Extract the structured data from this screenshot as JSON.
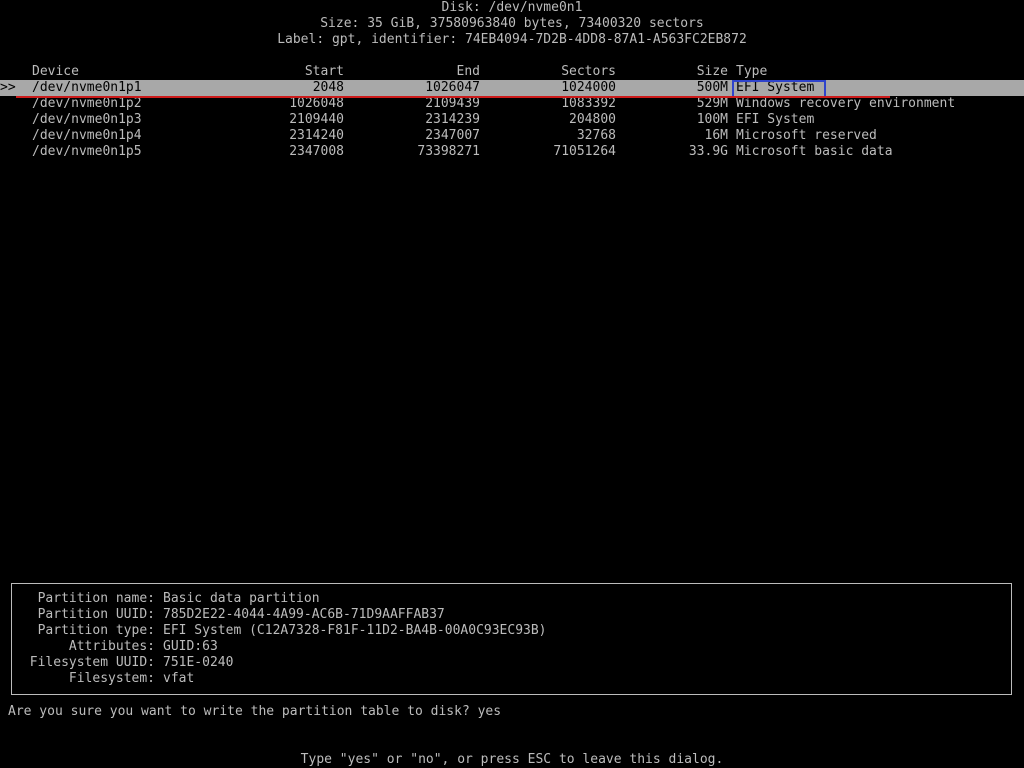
{
  "header": {
    "disk": "Disk: /dev/nvme0n1",
    "size": "Size: 35 GiB, 37580963840 bytes, 73400320 sectors",
    "label": "Label: gpt, identifier: 74EB4094-7D2B-4DD8-87A1-A563FC2EB872"
  },
  "table": {
    "headers": {
      "device": "Device",
      "start": "Start",
      "end": "End",
      "sectors": "Sectors",
      "size": "Size",
      "type": "Type"
    },
    "cursor": ">>",
    "rows": [
      {
        "device": "/dev/nvme0n1p1",
        "start": "2048",
        "end": "1026047",
        "sectors": "1024000",
        "size": "500M",
        "type": "EFI System"
      },
      {
        "device": "/dev/nvme0n1p2",
        "start": "1026048",
        "end": "2109439",
        "sectors": "1083392",
        "size": "529M",
        "type": "Windows recovery environment"
      },
      {
        "device": "/dev/nvme0n1p3",
        "start": "2109440",
        "end": "2314239",
        "sectors": "204800",
        "size": "100M",
        "type": "EFI System"
      },
      {
        "device": "/dev/nvme0n1p4",
        "start": "2314240",
        "end": "2347007",
        "sectors": "32768",
        "size": "16M",
        "type": "Microsoft reserved"
      },
      {
        "device": "/dev/nvme0n1p5",
        "start": "2347008",
        "end": "73398271",
        "sectors": "71051264",
        "size": "33.9G",
        "type": "Microsoft basic data"
      }
    ]
  },
  "info": [
    {
      "label": "Partition name:",
      "value": "Basic data partition"
    },
    {
      "label": "Partition UUID:",
      "value": "785D2E22-4044-4A99-AC6B-71D9AAFFAB37"
    },
    {
      "label": "Partition type:",
      "value": "EFI System (C12A7328-F81F-11D2-BA4B-00A0C93EC93B)"
    },
    {
      "label": "Attributes:",
      "value": "GUID:63"
    },
    {
      "label": "Filesystem UUID:",
      "value": "751E-0240"
    },
    {
      "label": "Filesystem:",
      "value": "vfat"
    }
  ],
  "prompt": {
    "question": "Are you sure you want to write the partition table to disk?",
    "answer": "yes"
  },
  "hint": "Type \"yes\" or \"no\", or press ESC to leave this dialog.",
  "colors": {
    "background": "#000000",
    "text": "#bcbcbc",
    "selected_row": "#a8a8a8",
    "annotation_box": "#2f44cc",
    "annotation_underline": "#cc1b1b"
  }
}
